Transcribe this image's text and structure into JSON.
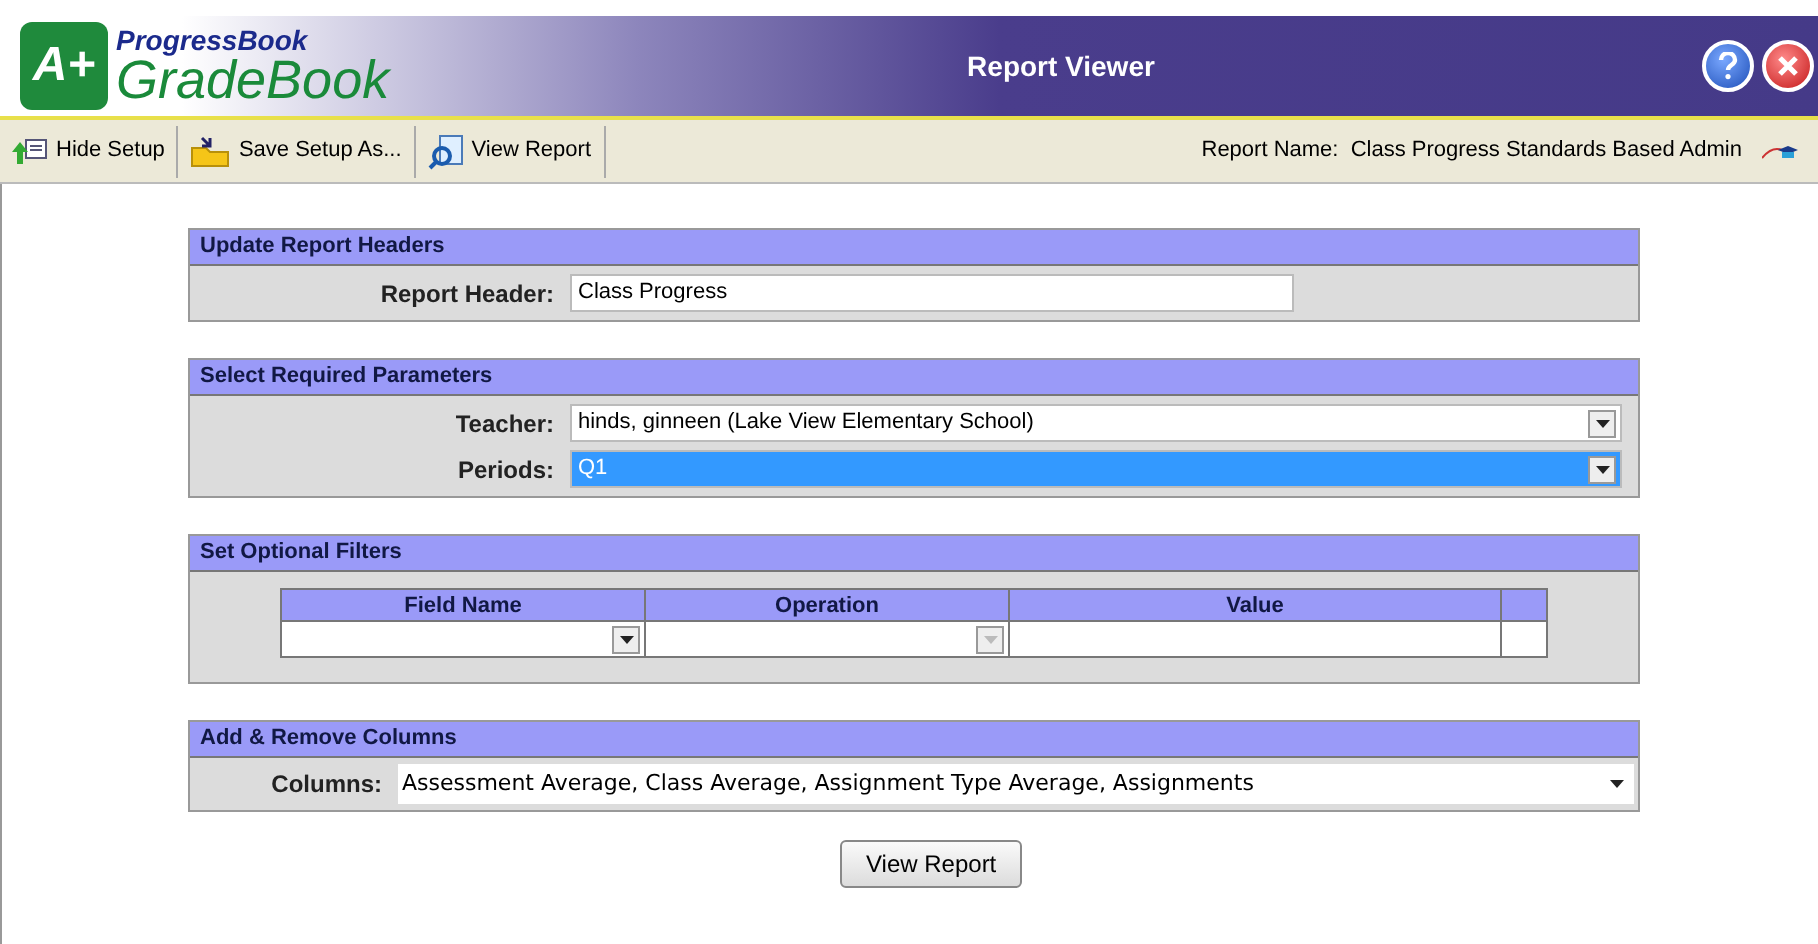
{
  "logo": {
    "badge": "A+",
    "brand": "ProgressBook",
    "product": "GradeBook"
  },
  "window": {
    "title": "Report Viewer"
  },
  "toolbar": {
    "buttons": [
      {
        "label": "Hide Setup",
        "kind": "hide"
      },
      {
        "label": "Save Setup As...",
        "kind": "save"
      },
      {
        "label": "View Report",
        "kind": "view"
      }
    ],
    "report_name_label": "Report Name:",
    "report_name": "Class Progress Standards Based Admin"
  },
  "sections": [
    {
      "title": "Update Report Headers",
      "kind": "fields",
      "fields": [
        {
          "label": "Report Header:",
          "value": "Class Progress",
          "kind": "text",
          "highlighted": false
        }
      ]
    },
    {
      "title": "Select Required Parameters",
      "kind": "fields",
      "fields": [
        {
          "label": "Teacher:",
          "value": "hinds, ginneen (Lake View Elementary School)",
          "kind": "select",
          "highlighted": false
        },
        {
          "label": "Periods:",
          "value": "Q1",
          "kind": "select",
          "highlighted": true
        }
      ]
    },
    {
      "title": "Set Optional Filters",
      "kind": "filters",
      "columns": [
        {
          "label": "Field Name",
          "kind": "select",
          "disabled": false
        },
        {
          "label": "Operation",
          "kind": "select",
          "disabled": true
        },
        {
          "label": "Value",
          "kind": "text"
        }
      ]
    },
    {
      "title": "Add & Remove Columns",
      "kind": "columns",
      "label": "Columns:",
      "value": "Assessment Average, Class Average, Assignment Type Average, Assignments"
    }
  ],
  "submit": "View Report"
}
